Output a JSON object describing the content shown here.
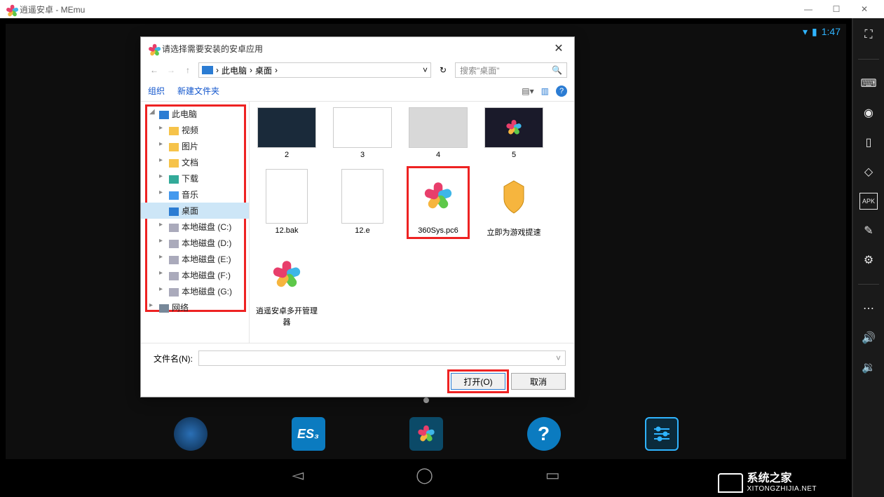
{
  "titlebar": {
    "title": "逍遥安卓 - MEmu"
  },
  "statusbar": {
    "time": "1:47"
  },
  "sidebar": {
    "items": [
      {
        "name": "fullscreen-icon"
      },
      {
        "name": "keyboard-icon"
      },
      {
        "name": "camera-icon"
      },
      {
        "name": "phone-icon"
      },
      {
        "name": "rotate-icon"
      },
      {
        "name": "apk-icon",
        "label": "APK"
      },
      {
        "name": "clean-icon"
      },
      {
        "name": "settings-icon"
      },
      {
        "name": "more-icon"
      },
      {
        "name": "volume-up-icon"
      },
      {
        "name": "volume-down-icon"
      }
    ]
  },
  "dock": {
    "items": [
      {
        "name": "browser-app"
      },
      {
        "name": "files-app",
        "label": "ES₃"
      },
      {
        "name": "market-app"
      },
      {
        "name": "help-app",
        "label": "?"
      },
      {
        "name": "settings-app"
      }
    ]
  },
  "filedialog": {
    "title": "请选择需要安装的安卓应用",
    "breadcrumb": {
      "root": "此电脑",
      "current": "桌面"
    },
    "search_placeholder": "搜索\"桌面\"",
    "toolbar": {
      "organize": "组织",
      "newfolder": "新建文件夹"
    },
    "tree": {
      "root": "此电脑",
      "items": [
        {
          "label": "视频"
        },
        {
          "label": "图片"
        },
        {
          "label": "文档"
        },
        {
          "label": "下载"
        },
        {
          "label": "音乐"
        },
        {
          "label": "桌面",
          "selected": true
        },
        {
          "label": "本地磁盘 (C:)"
        },
        {
          "label": "本地磁盘 (D:)"
        },
        {
          "label": "本地磁盘 (E:)"
        },
        {
          "label": "本地磁盘 (F:)"
        },
        {
          "label": "本地磁盘 (G:)"
        }
      ],
      "network": "网络"
    },
    "files": [
      {
        "label": "2",
        "type": "thumb"
      },
      {
        "label": "3",
        "type": "thumb"
      },
      {
        "label": "4",
        "type": "thumb"
      },
      {
        "label": "5",
        "type": "thumb"
      },
      {
        "label": "12.bak",
        "type": "doc"
      },
      {
        "label": "12.e",
        "type": "doc"
      },
      {
        "label": "360Sys.pc6",
        "type": "app",
        "highlight": true
      },
      {
        "label": "立即为游戏提速",
        "type": "app-shield"
      },
      {
        "label": "逍遥安卓多开管理器",
        "type": "app"
      }
    ],
    "footer": {
      "filename_label": "文件名(N):",
      "open": "打开(O)",
      "cancel": "取消"
    }
  },
  "watermark": {
    "cn": "系统之家",
    "en": "XITONGZHIJIA.NET"
  }
}
